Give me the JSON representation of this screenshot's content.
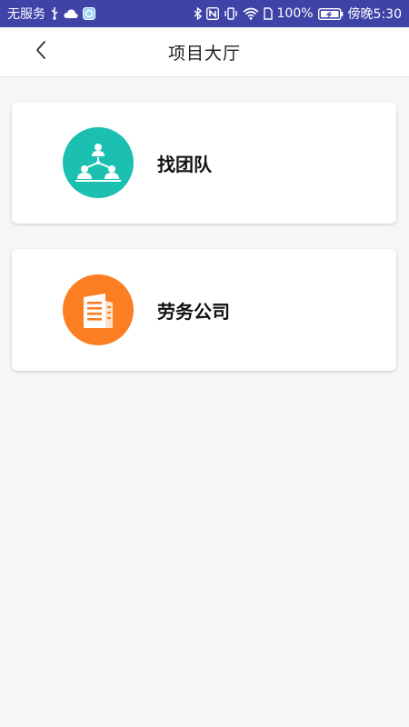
{
  "status_bar": {
    "carrier": "无服务",
    "battery": "100%",
    "time": "傍晚5:30",
    "icons": [
      "usb-icon",
      "cloud-icon",
      "app-icon",
      "bluetooth-icon",
      "nfc-icon",
      "vibrate-icon",
      "wifi-icon",
      "sim-icon",
      "battery-icon"
    ]
  },
  "header": {
    "title": "项目大厅",
    "back_icon": "chevron-left-icon"
  },
  "cards": [
    {
      "label": "找团队",
      "icon": "team-network-icon",
      "color": "#1cc0b1"
    },
    {
      "label": "劳务公司",
      "icon": "building-icon",
      "color": "#fc7e22"
    }
  ],
  "colors": {
    "status_bar_bg": "#3f43a8",
    "page_bg": "#f6f6f6",
    "card_bg": "#ffffff"
  }
}
